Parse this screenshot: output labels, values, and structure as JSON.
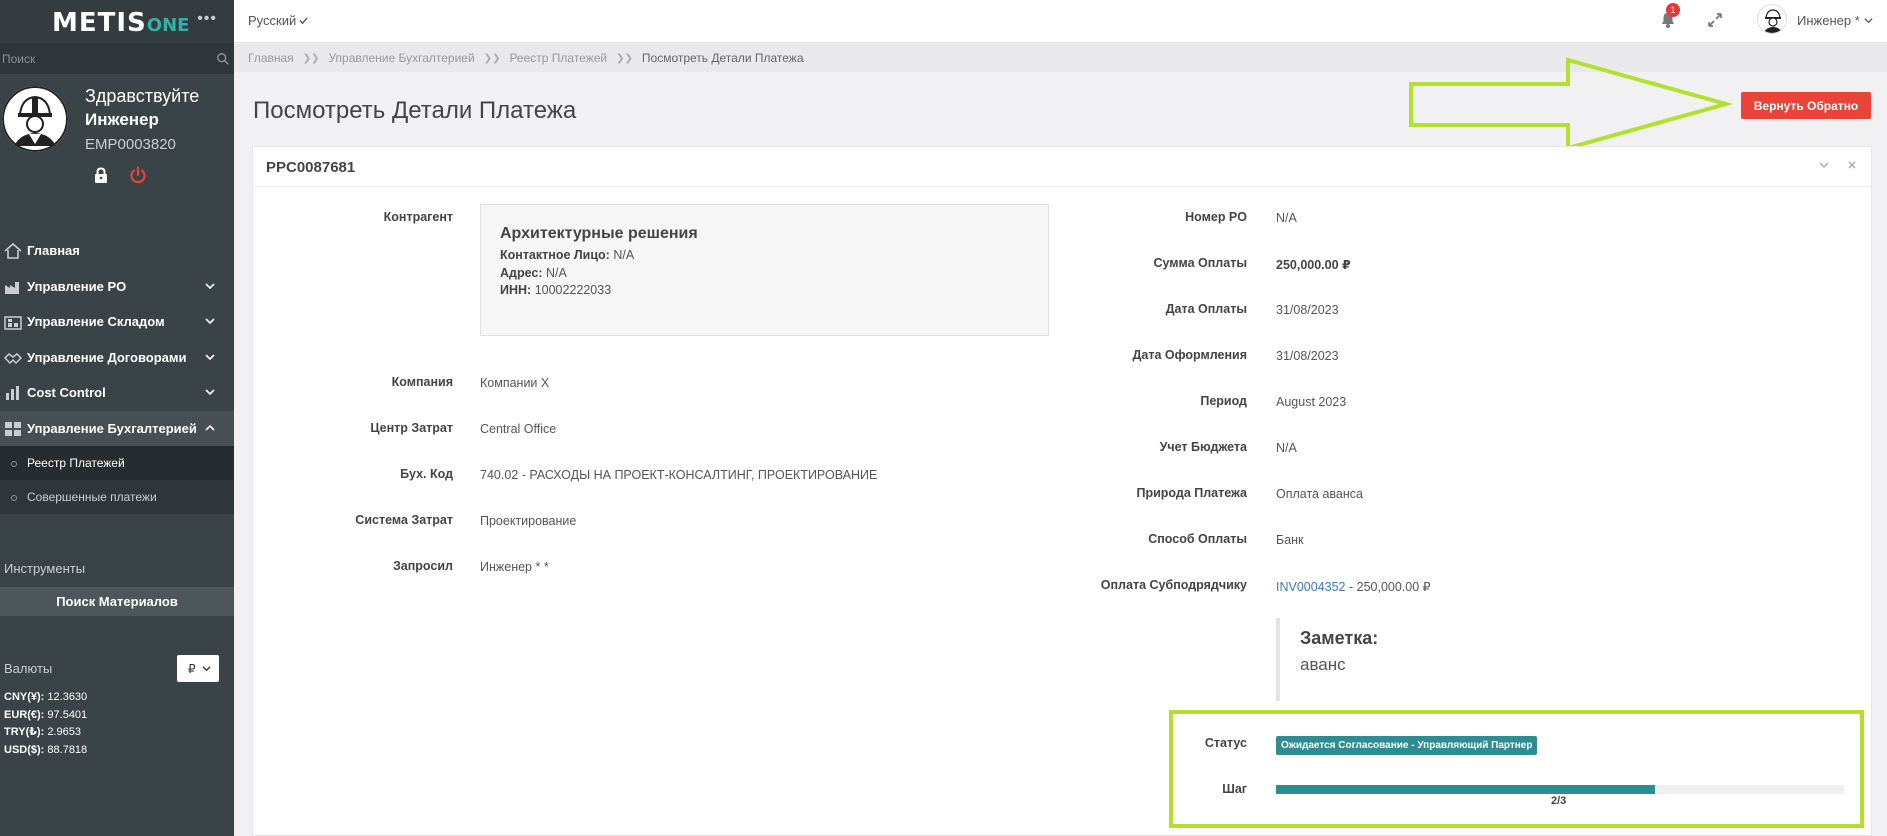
{
  "app": {
    "logo_main": "METIS",
    "logo_suffix": "ONE",
    "language": "Русский",
    "notification_count": "1",
    "user_label": "Инженер *"
  },
  "sidebar": {
    "search_placeholder": "Поиск",
    "greeting": "Здравствуйте",
    "user_name": "Инженер",
    "employee_id": "EMP0003820",
    "nav": [
      {
        "label": "Главная"
      },
      {
        "label": "Управление PO"
      },
      {
        "label": "Управление Складом"
      },
      {
        "label": "Управление Договорами"
      },
      {
        "label": "Cost Control"
      },
      {
        "label": "Управление Бухгалтерией"
      }
    ],
    "sub_items": [
      {
        "label": "Реестр Платежей"
      },
      {
        "label": "Совершенные платежи"
      }
    ],
    "tools_title": "Инструменты",
    "tools_button": "Поиск Материалов",
    "currency_title": "Валюты",
    "currency_selected": "₽",
    "rates": [
      {
        "code": "CNY(¥):",
        "value": "12.3630"
      },
      {
        "code": "EUR(€):",
        "value": "97.5401"
      },
      {
        "code": "TRY(₺):",
        "value": "2.9653"
      },
      {
        "code": "USD($):",
        "value": "88.7818"
      }
    ]
  },
  "breadcrumb": [
    "Главная",
    "Управление Бухгалтерией",
    "Реестр Платежей",
    "Посмотреть Детали Платежа"
  ],
  "header": {
    "title": "Посмотреть Детали Платежа",
    "back_button": "Вернуть Обратно"
  },
  "card": {
    "id": "PPC0087681",
    "left": {
      "contractor_label": "Контрагент",
      "contractor_name": "Архитектурные решения",
      "contact_label": "Контактное Лицо:",
      "contact_value": "N/A",
      "address_label": "Адрес:",
      "address_value": "N/A",
      "inn_label": "ИНН:",
      "inn_value": "10002222033",
      "company_label": "Компания",
      "company_value": "Компании Х",
      "cost_center_label": "Центр Затрат",
      "cost_center_value": "Central Office",
      "acct_code_label": "Бух. Код",
      "acct_code_value": "740.02 - РАСХОДЫ НА ПРОЕКТ-КОНСАЛТИНГ, ПРОЕКТИРОВАНИЕ",
      "cost_system_label": "Система Затрат",
      "cost_system_value": "Проектирование",
      "requested_label": "Запросил",
      "requested_value": "Инженер * *"
    },
    "right": {
      "po_label": "Номер PO",
      "po_value": "N/A",
      "amount_label": "Сумма Оплаты",
      "amount_value": "250,000.00 ₽",
      "pay_date_label": "Дата Оплаты",
      "pay_date_value": "31/08/2023",
      "reg_date_label": "Дата Оформления",
      "reg_date_value": "31/08/2023",
      "period_label": "Период",
      "period_value": "August 2023",
      "budget_label": "Учет Бюджета",
      "budget_value": "N/A",
      "nature_label": "Природа Платежа",
      "nature_value": "Оплата аванса",
      "method_label": "Способ Оплаты",
      "method_value": "Банк",
      "subcontractor_label": "Оплата Субподрядчику",
      "subcontractor_link": "INV0004352",
      "subcontractor_amount": " - 250,000.00 ₽",
      "note_title": "Заметка:",
      "note_text": "аванс",
      "status_label": "Статус",
      "status_value": "Ожидается Согласование - Управляющий Партнер",
      "step_label": "Шаг",
      "step_text": "2/3",
      "step_progress": 0.667
    }
  },
  "colors": {
    "sidebar_bg": "#3a4347",
    "accent_teal": "#2e8d92",
    "danger": "#e8443a",
    "highlight_green": "#b3e02e",
    "link": "#3a7ab8"
  }
}
